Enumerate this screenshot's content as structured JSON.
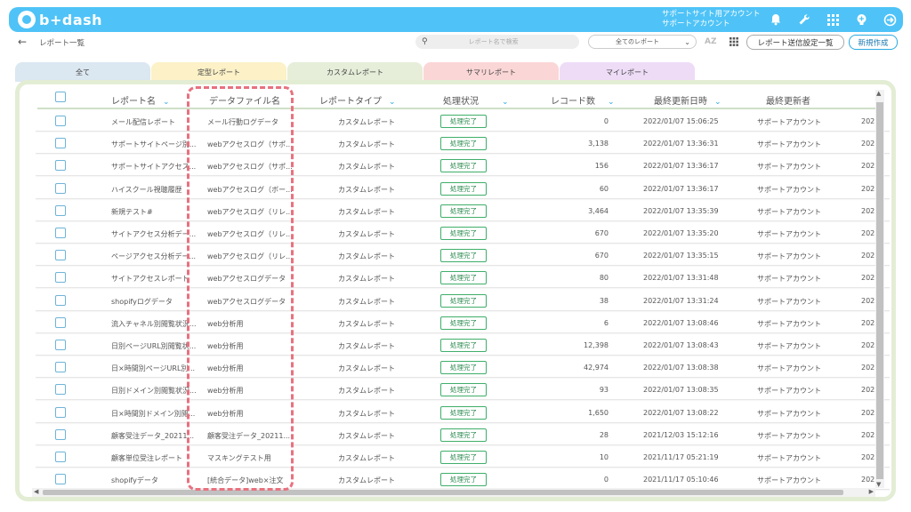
{
  "app": {
    "logo_text": "b+dash"
  },
  "account": {
    "line1": "サポートサイト用アカウント",
    "line2": "サポートアカウント"
  },
  "topbar_icons": [
    "bell-icon",
    "wrench-icon",
    "apps-icon",
    "bulb-icon",
    "logout-icon"
  ],
  "breadcrumb": {
    "back": "←",
    "label": "レポート一覧"
  },
  "search": {
    "placeholder": "レポート名で検索"
  },
  "filter": {
    "value": "全てのレポート"
  },
  "toolbar": {
    "az": "AZ",
    "settings_label": "レポート送信設定一覧",
    "new_label": "新規作成"
  },
  "tabs": [
    {
      "label": "全て",
      "color": "#dbe7f1"
    },
    {
      "label": "定型レポート",
      "color": "#fcf1c7"
    },
    {
      "label": "カスタムレポート",
      "color": "#e6eed9"
    },
    {
      "label": "サマリレポート",
      "color": "#fbd6d6"
    },
    {
      "label": "マイレポート",
      "color": "#eedcf7"
    }
  ],
  "columns": {
    "name": "レポート名",
    "file": "データファイル名",
    "type": "レポートタイプ",
    "status": "処理状況",
    "records": "レコード数",
    "updated": "最終更新日時",
    "updater": "最終更新者"
  },
  "rows": [
    {
      "name": "メール配信レポート",
      "file": "メール行動ログデータ",
      "type": "カスタムレポート",
      "status": "処理完了",
      "records": "0",
      "updated": "2022/01/07 15:06:25",
      "updater": "サポートアカウント",
      "extra": "202"
    },
    {
      "name": "サポートサイトページ別...",
      "file": "webアクセスログ（サポ...",
      "type": "カスタムレポート",
      "status": "処理完了",
      "records": "3,138",
      "updated": "2022/01/07 13:36:31",
      "updater": "サポートアカウント",
      "extra": "202"
    },
    {
      "name": "サポートサイトアクセス...",
      "file": "webアクセスログ（サポ...",
      "type": "カスタムレポート",
      "status": "処理完了",
      "records": "156",
      "updated": "2022/01/07 13:36:17",
      "updater": "サポートアカウント",
      "extra": "202"
    },
    {
      "name": "ハイスクール視聴履歴",
      "file": "webアクセスログ（ボー...",
      "type": "カスタムレポート",
      "status": "処理完了",
      "records": "60",
      "updated": "2022/01/07 13:36:17",
      "updater": "サポートアカウント",
      "extra": "202"
    },
    {
      "name": "新規テスト#",
      "file": "webアクセスログ（リレ...",
      "type": "カスタムレポート",
      "status": "処理完了",
      "records": "3,464",
      "updated": "2022/01/07 13:35:39",
      "updater": "サポートアカウント",
      "extra": "202"
    },
    {
      "name": "サイトアクセス分析デー...",
      "file": "webアクセスログ（リレ...",
      "type": "カスタムレポート",
      "status": "処理完了",
      "records": "670",
      "updated": "2022/01/07 13:35:20",
      "updater": "サポートアカウント",
      "extra": "202"
    },
    {
      "name": "ページアクセス分析デー...",
      "file": "webアクセスログ（リレ...",
      "type": "カスタムレポート",
      "status": "処理完了",
      "records": "670",
      "updated": "2022/01/07 13:35:15",
      "updater": "サポートアカウント",
      "extra": "202"
    },
    {
      "name": "サイトアクセスレポート",
      "file": "webアクセスログデータ",
      "type": "カスタムレポート",
      "status": "処理完了",
      "records": "80",
      "updated": "2022/01/07 13:31:48",
      "updater": "サポートアカウント",
      "extra": "202"
    },
    {
      "name": "shopifyログデータ",
      "file": "webアクセスログデータ",
      "type": "カスタムレポート",
      "status": "処理完了",
      "records": "38",
      "updated": "2022/01/07 13:31:24",
      "updater": "サポートアカウント",
      "extra": "202"
    },
    {
      "name": "流入チャネル別閲覧状況...",
      "file": "web分析用",
      "type": "カスタムレポート",
      "status": "処理完了",
      "records": "6",
      "updated": "2022/01/07 13:08:46",
      "updater": "サポートアカウント",
      "extra": "202"
    },
    {
      "name": "日別ページURL別閲覧状...",
      "file": "web分析用",
      "type": "カスタムレポート",
      "status": "処理完了",
      "records": "12,398",
      "updated": "2022/01/07 13:08:43",
      "updater": "サポートアカウント",
      "extra": "202"
    },
    {
      "name": "日×時間別ページURL別...",
      "file": "web分析用",
      "type": "カスタムレポート",
      "status": "処理完了",
      "records": "42,974",
      "updated": "2022/01/07 13:08:38",
      "updater": "サポートアカウント",
      "extra": "202"
    },
    {
      "name": "日別ドメイン別閲覧状況...",
      "file": "web分析用",
      "type": "カスタムレポート",
      "status": "処理完了",
      "records": "93",
      "updated": "2022/01/07 13:08:35",
      "updater": "サポートアカウント",
      "extra": "202"
    },
    {
      "name": "日×時間別ドメイン別閲...",
      "file": "web分析用",
      "type": "カスタムレポート",
      "status": "処理完了",
      "records": "1,650",
      "updated": "2022/01/07 13:08:22",
      "updater": "サポートアカウント",
      "extra": "202"
    },
    {
      "name": "顧客受注データ_20211...",
      "file": "顧客受注データ_20211...",
      "type": "カスタムレポート",
      "status": "処理完了",
      "records": "28",
      "updated": "2021/12/03 15:12:16",
      "updater": "サポートアカウント",
      "extra": "202"
    },
    {
      "name": "顧客単位受注レポート",
      "file": "マスキングテスト用",
      "type": "カスタムレポート",
      "status": "処理完了",
      "records": "10",
      "updated": "2021/11/17 05:21:19",
      "updater": "サポートアカウント",
      "extra": "202"
    },
    {
      "name": "shopifyデータ",
      "file": "[統合データ]web×注文",
      "type": "カスタムレポート",
      "status": "処理完了",
      "records": "0",
      "updated": "2021/11/17 05:10:46",
      "updater": "サポートアカウント",
      "extra": "202"
    }
  ],
  "colors": {
    "accent": "#4fc3f7",
    "badge": "#3fae6a",
    "highlight": "#e8717f"
  }
}
